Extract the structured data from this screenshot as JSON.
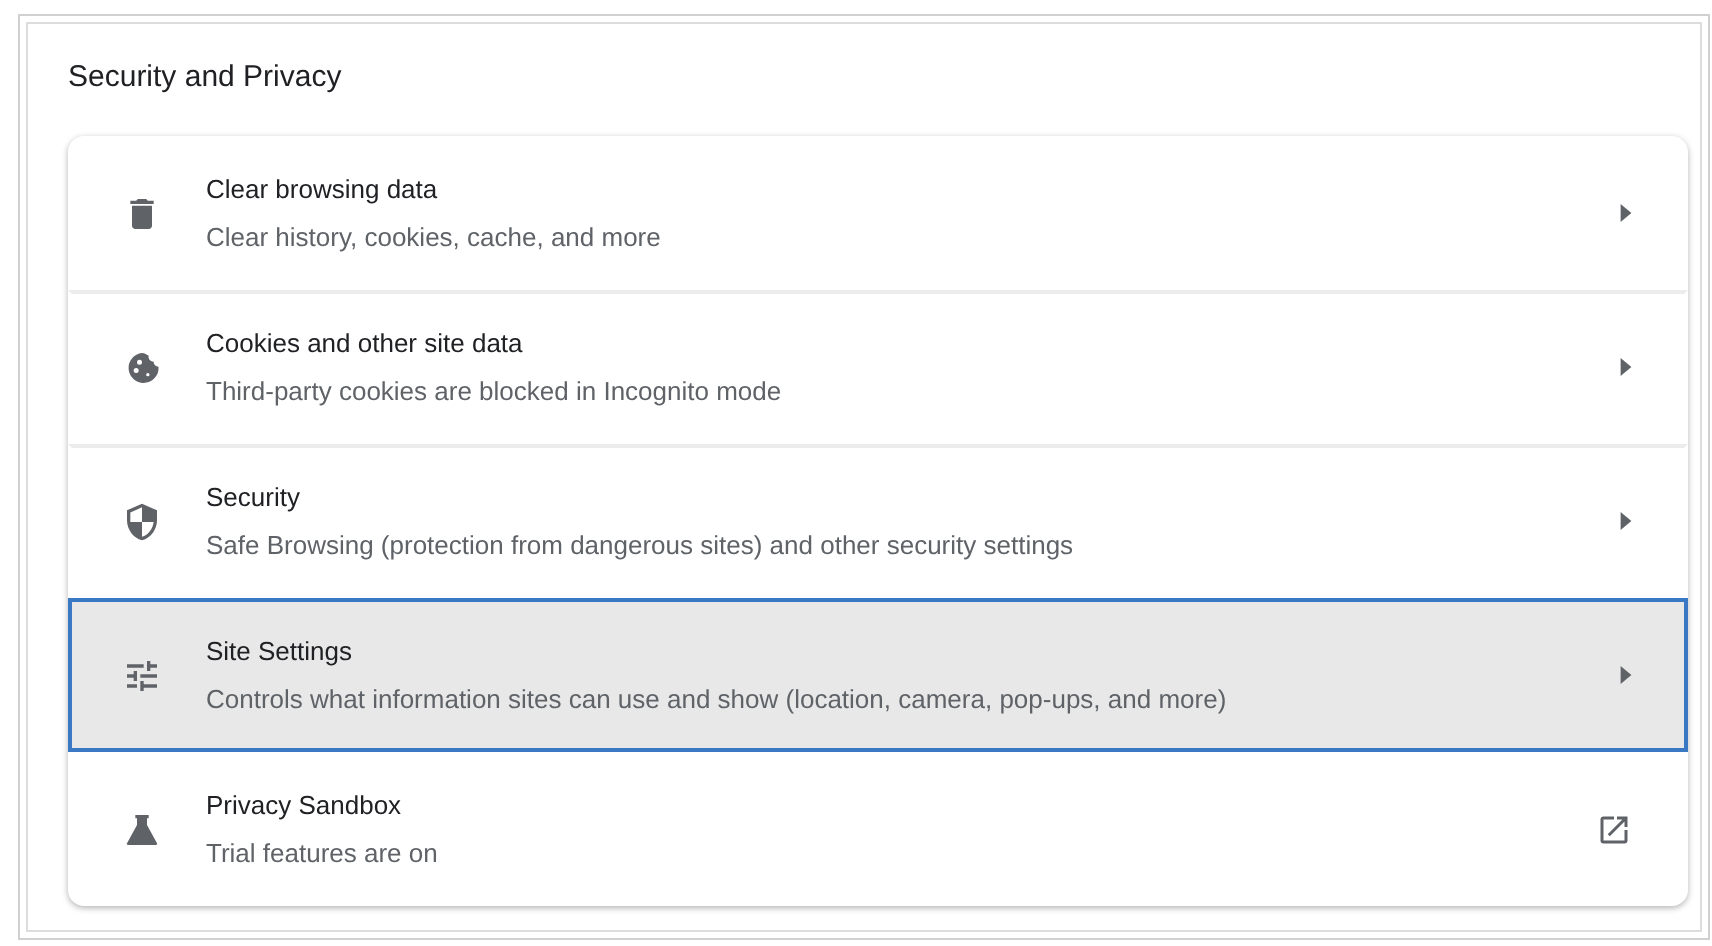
{
  "section": {
    "title": "Security and Privacy"
  },
  "items": [
    {
      "kind": "submenu",
      "title": "Clear browsing data",
      "subtitle": "Clear history, cookies, cache, and more",
      "selected": false
    },
    {
      "kind": "submenu",
      "title": "Cookies and other site data",
      "subtitle": "Third-party cookies are blocked in Incognito mode",
      "selected": false
    },
    {
      "kind": "submenu",
      "title": "Security",
      "subtitle": "Safe Browsing (protection from dangerous sites) and other security settings",
      "selected": false
    },
    {
      "kind": "submenu",
      "title": "Site Settings",
      "subtitle": "Controls what information sites can use and show (location, camera, pop-ups, and more)",
      "selected": true
    },
    {
      "kind": "external",
      "title": "Privacy Sandbox",
      "subtitle": "Trial features are on",
      "selected": false
    }
  ]
}
